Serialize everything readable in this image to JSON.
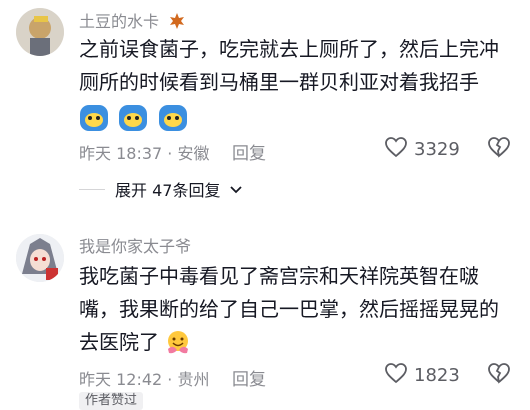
{
  "comments": [
    {
      "author": "土豆的水卡",
      "lines": [
        "之前误食菌子，吃完就去上厕所了，然后上完冲",
        "厕所的时候看到马桶里一群贝利亚对着我招手"
      ],
      "time": "昨天 18:37",
      "location": "安徽",
      "reply_label": "回复",
      "likes": "3329",
      "expand_label": "展开 47条回复"
    },
    {
      "author": "我是你家太子爷",
      "lines": [
        "我吃菌子中毒看见了斋宫宗和天祥院英智在啵",
        "嘴，我果断的给了自己一巴掌，然后摇摇晃晃的",
        "去医院了"
      ],
      "time": "昨天 12:42",
      "location": "贵州",
      "reply_label": "回复",
      "likes": "1823",
      "badge": "作者赞过"
    }
  ],
  "colors": {
    "secondary_text": "#8a8b91",
    "primary_text": "#161823",
    "icon": "#5c5d63"
  },
  "icons": [
    "maple-leaf-icon",
    "emoji-face-icon",
    "heart-outline-icon",
    "broken-heart-icon",
    "chevron-down-icon",
    "hug-emoji-icon"
  ]
}
